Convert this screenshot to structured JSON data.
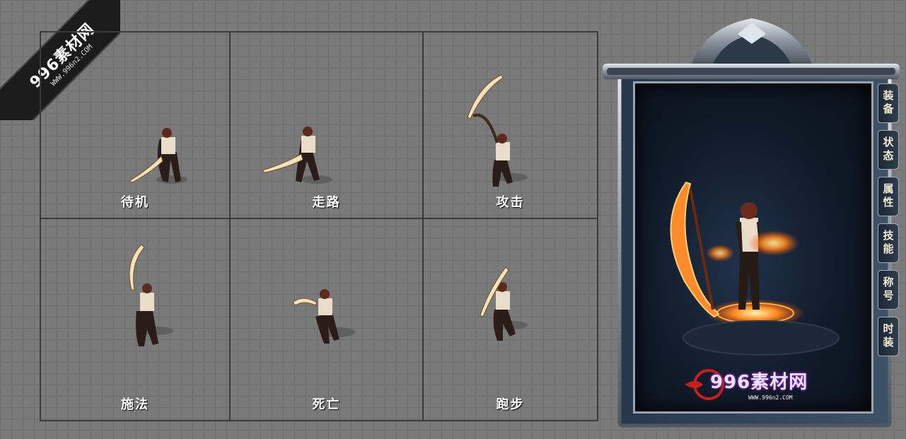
{
  "watermark": {
    "title": "996素材网",
    "url": "WWW.996n2.COM",
    "panel_title": "996素材网",
    "panel_url": "WWW.996n2.COM"
  },
  "animations": [
    {
      "id": "idle",
      "label": "待机"
    },
    {
      "id": "walk",
      "label": "走路"
    },
    {
      "id": "attack",
      "label": "攻击"
    },
    {
      "id": "cast",
      "label": "施法"
    },
    {
      "id": "death",
      "label": "死亡"
    },
    {
      "id": "run",
      "label": "跑步"
    }
  ],
  "tabs": [
    {
      "label": "装备"
    },
    {
      "label": "状态"
    },
    {
      "label": "属性"
    },
    {
      "label": "技能"
    },
    {
      "label": "称号"
    },
    {
      "label": "时装"
    }
  ],
  "colors": {
    "background": "#7a7a7a",
    "grid_border": "#3a3a3a",
    "label": "#ffffff",
    "panel_bg": "#101a28",
    "frame_silver": "#9aa3ad",
    "fire": "#ff7a1a"
  },
  "icons": [
    "sword-character-sprite",
    "scythe-fire-character",
    "corner-watermark-banner"
  ]
}
